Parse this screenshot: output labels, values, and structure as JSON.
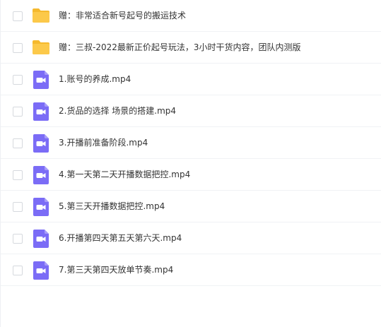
{
  "files": [
    {
      "name": "赠：非常适合新号起号的搬运技术",
      "icon": "folder-icon",
      "type": "folder"
    },
    {
      "name": "赠：三叔-2022最新正价起号玩法，3小时干货内容，团队内测版",
      "icon": "folder-icon",
      "type": "folder"
    },
    {
      "name": "1.账号的养成.mp4",
      "icon": "video-file-icon",
      "type": "video"
    },
    {
      "name": "2.货品的选择 场景的搭建.mp4",
      "icon": "video-file-icon",
      "type": "video"
    },
    {
      "name": "3.开播前准备阶段.mp4",
      "icon": "video-file-icon",
      "type": "video"
    },
    {
      "name": "4.第一天第二天开播数据把控.mp4",
      "icon": "video-file-icon",
      "type": "video"
    },
    {
      "name": "5.第三天开播数据把控.mp4",
      "icon": "video-file-icon",
      "type": "video"
    },
    {
      "name": "6.开播第四天第五天第六天.mp4",
      "icon": "video-file-icon",
      "type": "video"
    },
    {
      "name": "7.第三天第四天放单节奏.mp4",
      "icon": "video-file-icon",
      "type": "video"
    }
  ],
  "colors": {
    "folder": "#fcc94a",
    "folder_tab": "#f5b92e",
    "video": "#7b6cf6",
    "text": "#333333",
    "divider": "#f0f2f5"
  }
}
